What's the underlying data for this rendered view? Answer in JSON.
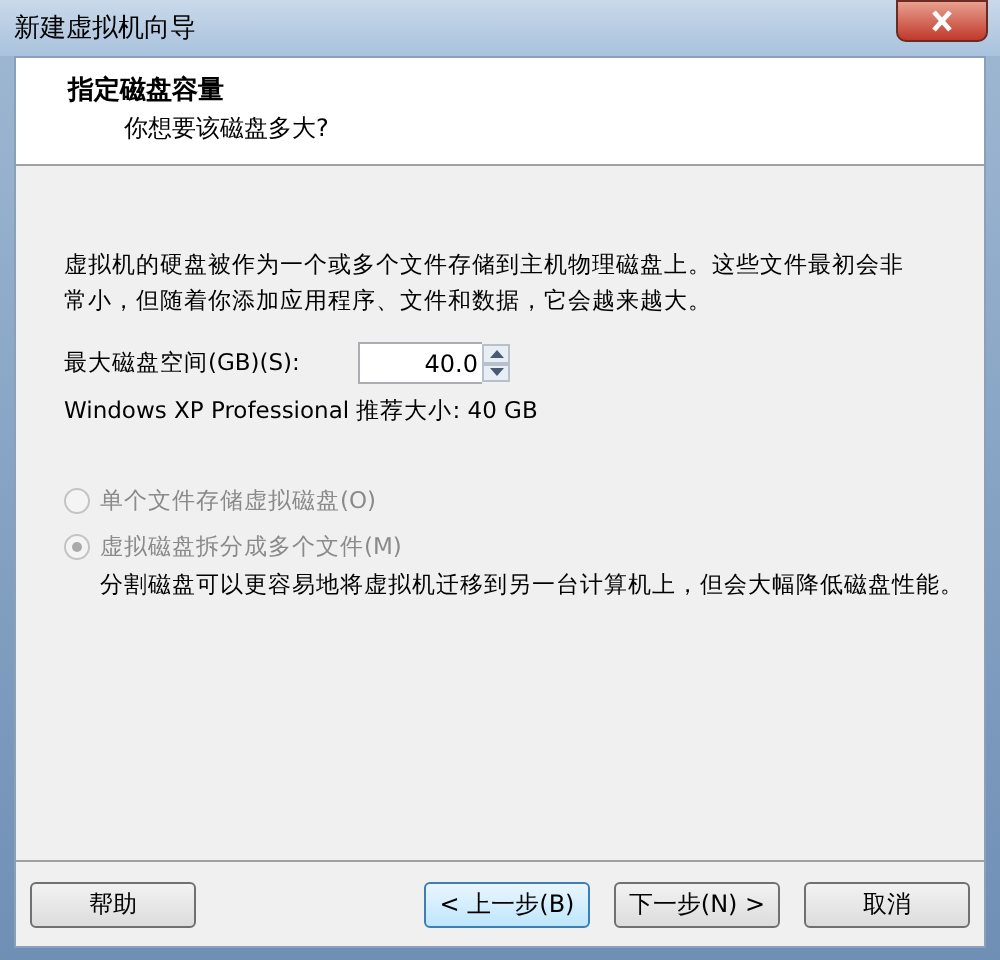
{
  "window": {
    "title": "新建虚拟机向导"
  },
  "header": {
    "title": "指定磁盘容量",
    "subtitle": "你想要该磁盘多大?"
  },
  "description": "虚拟机的硬盘被作为一个或多个文件存储到主机物理磁盘上。这些文件最初会非常小，但随着你添加应用程序、文件和数据，它会越来越大。",
  "disk_size": {
    "label": "最大磁盘空间(GB)(S):",
    "value": "40.0"
  },
  "recommendation": "Windows XP Professional 推荐大小: 40 GB",
  "options": [
    {
      "label": "单个文件存储虚拟磁盘(O)",
      "selected": false,
      "disabled": true
    },
    {
      "label": "虚拟磁盘拆分成多个文件(M)",
      "selected": true,
      "disabled": true,
      "note": "分割磁盘可以更容易地将虚拟机迁移到另一台计算机上，但会大幅降低磁盘性能。"
    }
  ],
  "buttons": [
    {
      "label": "帮助",
      "focused": false
    },
    {
      "label": "< 上一步(B)",
      "focused": true
    },
    {
      "label": "下一步(N) >",
      "focused": false
    },
    {
      "label": "取消",
      "focused": false
    }
  ]
}
